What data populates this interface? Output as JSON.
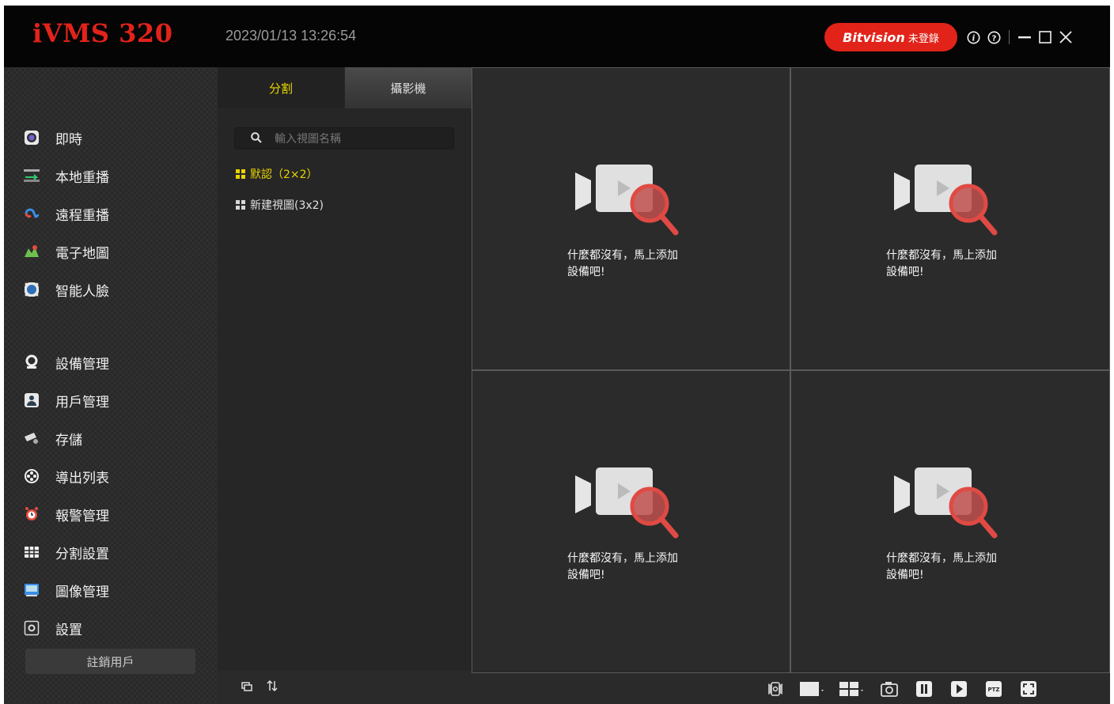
{
  "app": {
    "title": "iVMS 320",
    "datetime": "2023/01/13 13:26:54",
    "brand": {
      "name": "Bitvision",
      "status": "未登錄",
      "color": "#e2231a"
    }
  },
  "titlebar_icons": [
    "info-icon",
    "help-icon",
    "minimize-icon",
    "maximize-icon",
    "close-icon"
  ],
  "sidebar": {
    "items": [
      {
        "label": "即時",
        "icon": "live-camera-icon"
      },
      {
        "label": "本地重播",
        "icon": "local-playback-icon"
      },
      {
        "label": "遠程重播",
        "icon": "remote-playback-icon"
      },
      {
        "label": "電子地圖",
        "icon": "emap-icon"
      },
      {
        "label": "智能人臉",
        "icon": "face-recognition-icon"
      },
      {
        "label": "設備管理",
        "icon": "device-manage-icon"
      },
      {
        "label": "用戶管理",
        "icon": "user-manage-icon"
      },
      {
        "label": "存儲",
        "icon": "storage-icon"
      },
      {
        "label": "導出列表",
        "icon": "export-list-icon"
      },
      {
        "label": "報警管理",
        "icon": "alarm-icon"
      },
      {
        "label": "分割設置",
        "icon": "split-settings-icon"
      },
      {
        "label": "圖像管理",
        "icon": "image-manage-icon"
      },
      {
        "label": "設置",
        "icon": "settings-icon"
      }
    ],
    "logout_label": "註銷用戶"
  },
  "panel": {
    "tabs": [
      {
        "label": "分割",
        "active": true
      },
      {
        "label": "攝影機",
        "active": false
      }
    ],
    "search_placeholder": "輸入視圖名稱",
    "views": [
      {
        "label": "默認（2×2）",
        "selected": true
      },
      {
        "label": "新建視圖(3x2)",
        "selected": false
      }
    ]
  },
  "video_grid": {
    "layout": "2x2",
    "empty_message": "什麼都沒有，馬上添加\n設備吧!"
  },
  "toolbar": [
    "record-toggle-icon",
    "single-layout-icon",
    "quad-layout-icon",
    "snapshot-icon",
    "pause-icon",
    "play-icon",
    "ptz-icon",
    "fullscreen-icon"
  ],
  "colors": {
    "accent": "#e8d400",
    "brand_red": "#e2231a",
    "background": "#2b2b2b"
  }
}
